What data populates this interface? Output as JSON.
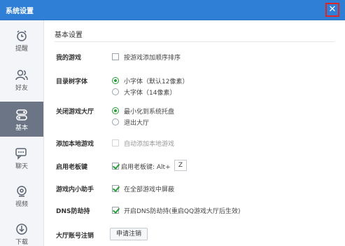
{
  "window": {
    "title": "系统设置",
    "close_label": "✕"
  },
  "sidebar": {
    "items": [
      {
        "label": "提醒",
        "icon": "alarm-clock-icon"
      },
      {
        "label": "好友",
        "icon": "friends-icon"
      },
      {
        "label": "基本",
        "icon": "basic-settings-icon",
        "active": true
      },
      {
        "label": "聊天",
        "icon": "chat-icon"
      },
      {
        "label": "视频",
        "icon": "video-icon"
      },
      {
        "label": "下载",
        "icon": "download-icon"
      }
    ]
  },
  "main": {
    "section_title": "基本设置",
    "rows": {
      "my_games": {
        "label": "我的游戏",
        "option": "按游戏添加顺序排序"
      },
      "tree_font": {
        "label": "目录树字体",
        "small": "小字体（默认12像素）",
        "large": "大字体（14像素）"
      },
      "close_hall": {
        "label": "关闭游戏大厅",
        "minimize": "最小化到系统托盘",
        "exit": "退出大厅"
      },
      "add_local": {
        "label": "添加本地游戏",
        "option": "自动添加本地游戏"
      },
      "boss_key": {
        "label": "启用老板键",
        "option": "启用老板键: Alt+",
        "key": "Z"
      },
      "helper": {
        "label": "游戏内小助手",
        "option": "在全部游戏中屏蔽"
      },
      "dns": {
        "label": "DNS防劫持",
        "option": "开启DNS防劫持(重启QQ游戏大厅后生效)"
      },
      "account": {
        "label": "大厅账号注销",
        "button": "申请注销"
      }
    }
  },
  "colors": {
    "titlebar": "#2f7fd6",
    "accent_green": "#2a9e3a",
    "sidebar_active": "#6b7585",
    "close_highlight": "#e02525"
  }
}
